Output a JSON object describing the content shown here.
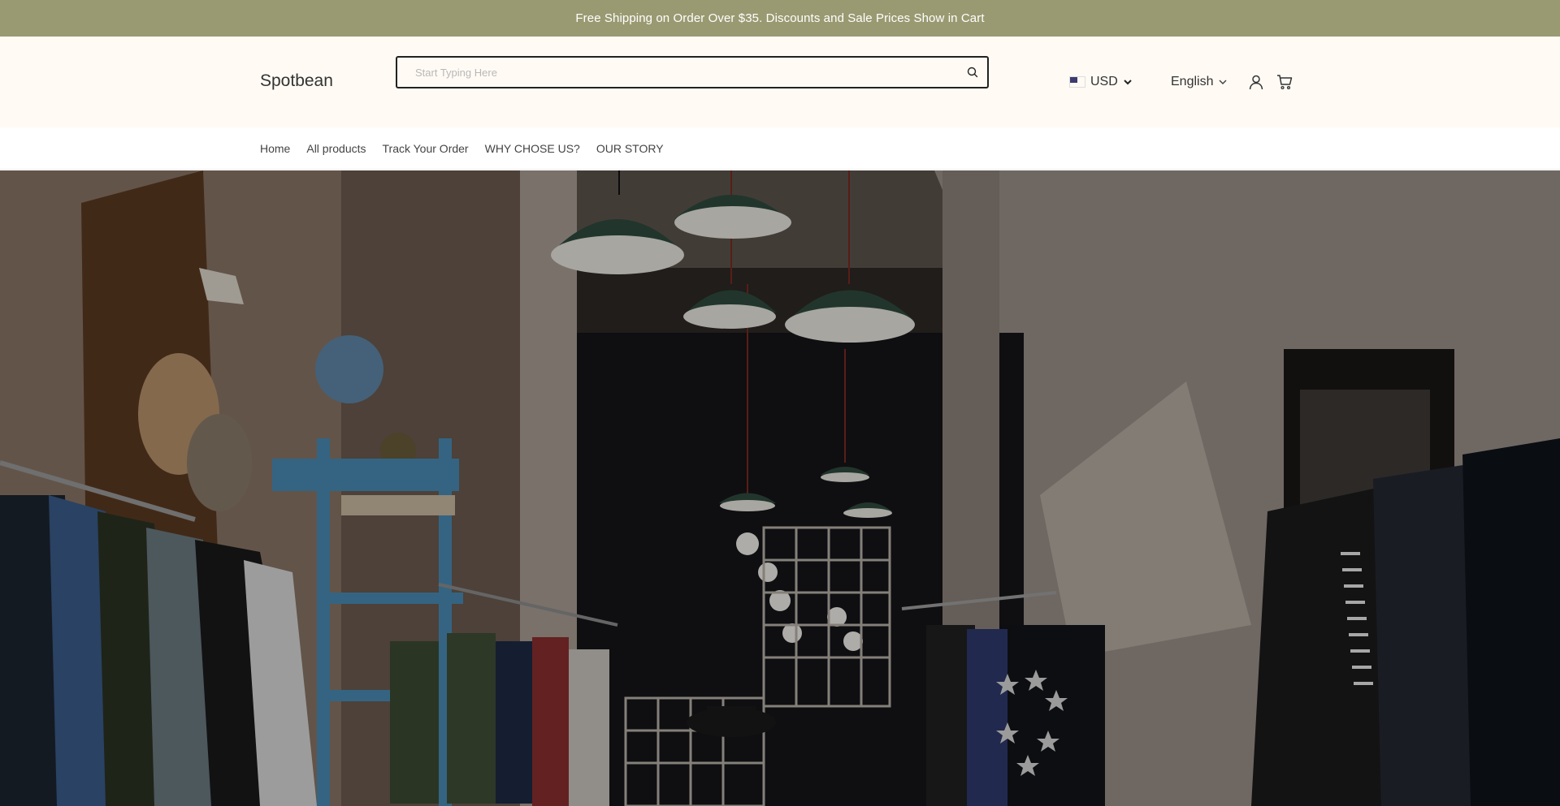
{
  "announcement": {
    "text": "Free Shipping on Order Over $35. Discounts and Sale Prices Show in Cart"
  },
  "header": {
    "logo": "Spotbean",
    "search": {
      "placeholder": "Start Typing Here",
      "value": ""
    },
    "currency": {
      "flag": "us-flag-icon",
      "selected": "USD"
    },
    "language": {
      "selected": "English"
    },
    "icons": {
      "search": "search-icon",
      "account": "user-icon",
      "cart": "cart-icon"
    }
  },
  "nav": {
    "items": [
      {
        "label": "Home"
      },
      {
        "label": "All products"
      },
      {
        "label": "Track Your Order"
      },
      {
        "label": "WHY CHOSE US?"
      },
      {
        "label": "OUR STORY"
      }
    ]
  },
  "colors": {
    "announcement_bg": "#9a9a72",
    "header_bg": "#fffaf4",
    "text": "#333333"
  }
}
